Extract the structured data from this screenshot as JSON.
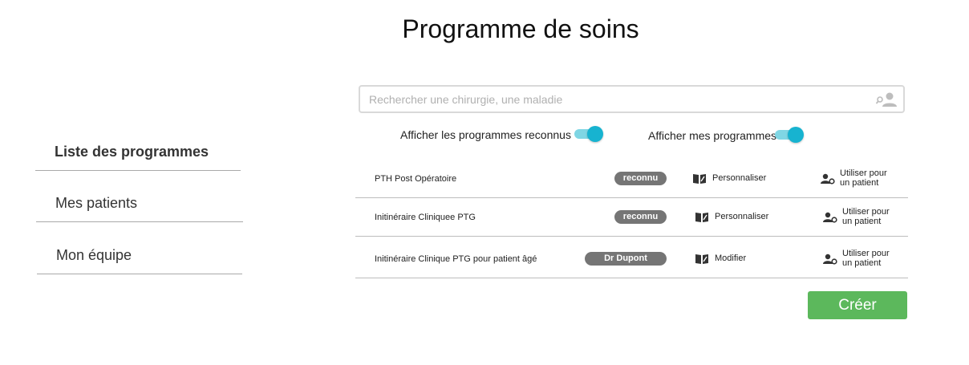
{
  "page": {
    "title": "Programme de soins"
  },
  "sidebar": {
    "items": [
      {
        "label": "Liste des programmes",
        "active": true
      },
      {
        "label": "Mes patients",
        "active": false
      },
      {
        "label": "Mon équipe",
        "active": false
      }
    ]
  },
  "search": {
    "placeholder": "Rechercher une chirurgie, une maladie",
    "value": "",
    "icon": "user-search-icon"
  },
  "filters": {
    "recognized": {
      "label": "Afficher les programmes reconnus",
      "on": true
    },
    "mine": {
      "label": "Afficher mes programmes",
      "on": true
    }
  },
  "programs": [
    {
      "name": "PTH Post Opératoire",
      "badge": "reconnu",
      "action": "Personnaliser",
      "use_line1": "Utiliser pour",
      "use_line2": "un patient"
    },
    {
      "name": "Initinéraire Cliniquee PTG",
      "badge": "reconnu",
      "action": "Personnaliser",
      "use_line1": "Utiliser pour",
      "use_line2": "un patient"
    },
    {
      "name": "Initinéraire Clinique PTG pour patient âgé",
      "badge": "Dr Dupont",
      "action": "Modifier",
      "use_line1": "Utiliser pour",
      "use_line2": "un patient"
    }
  ],
  "create_button": {
    "label": "Créer"
  },
  "colors": {
    "toggle_track": "#7fd6e4",
    "toggle_knob": "#17b3d0",
    "badge": "#757575",
    "create": "#5cb85c"
  }
}
